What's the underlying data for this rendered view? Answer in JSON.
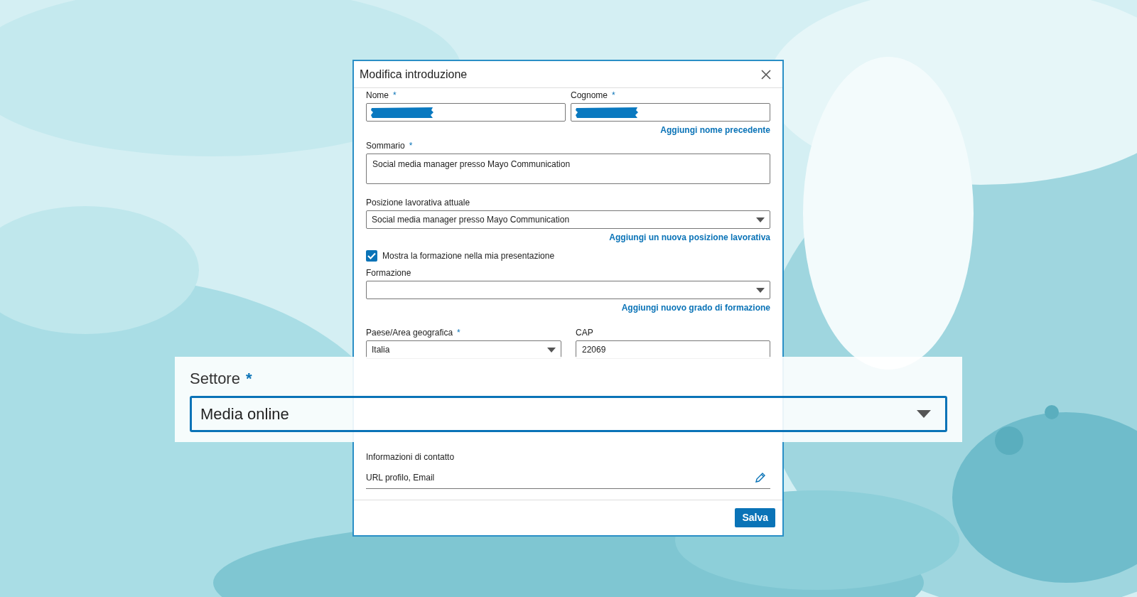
{
  "dialog": {
    "title": "Modifica introduzione",
    "name_fields": [
      {
        "label": "Nome",
        "required_mark": "*",
        "redacted": true
      },
      {
        "label": "Cognome",
        "required_mark": "*",
        "redacted": true
      }
    ],
    "previous_name_link": "Aggiungi nome precedente",
    "summary": {
      "label": "Sommario",
      "required_mark": "*",
      "value": "Social media manager presso Mayo Communication"
    },
    "current_position": {
      "label": "Posizione lavorativa attuale",
      "value": "Social media manager presso Mayo Communication"
    },
    "new_position_link": "Aggiungi un nuova posizione lavorativa",
    "show_education": {
      "label": "Mostra la formazione nella mia presentazione",
      "checked": true
    },
    "education": {
      "label": "Formazione"
    },
    "new_education_link": "Aggiungi nuovo grado di formazione",
    "country": {
      "label": "Paese/Area geografica",
      "required_mark": "*",
      "value": "Italia"
    },
    "postal_code": {
      "label": "CAP",
      "value": "22069"
    },
    "contact_info": {
      "label": "Informazioni di contatto",
      "value": "URL profilo, Email"
    },
    "save_button": "Salva"
  },
  "zoom_callout": {
    "label": "Settore",
    "required_mark": "*",
    "value": "Media online"
  }
}
